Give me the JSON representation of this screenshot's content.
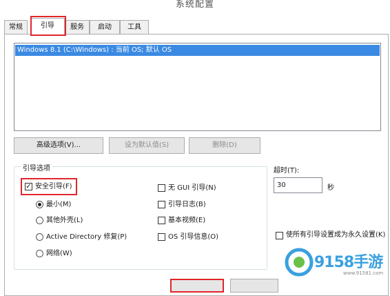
{
  "window": {
    "title": "系统配置"
  },
  "tabs": [
    {
      "label": "常规"
    },
    {
      "label": "引导"
    },
    {
      "label": "服务"
    },
    {
      "label": "启动"
    },
    {
      "label": "工具"
    }
  ],
  "boot_list": {
    "items": [
      "Windows 8.1 (C:\\Windows) : 当前 OS; 默认 OS"
    ]
  },
  "buttons": {
    "advanced": "高级选项(V)...",
    "set_default": "设为默认值(S)",
    "delete": "删除(D)"
  },
  "boot_options": {
    "group_label": "引导选项",
    "safe_boot": {
      "label": "安全引导(F)",
      "checked": true
    },
    "radios": [
      {
        "label": "最小(M)",
        "selected": true
      },
      {
        "label": "其他外壳(L)",
        "selected": false
      },
      {
        "label": "Active Directory 修复(P)",
        "selected": false
      },
      {
        "label": "网络(W)",
        "selected": false
      }
    ],
    "checks": [
      {
        "label": "无 GUI 引导(N)",
        "checked": false
      },
      {
        "label": "引导日志(B)",
        "checked": false
      },
      {
        "label": "基本视频(E)",
        "checked": false
      },
      {
        "label": "OS 引导信息(O)",
        "checked": false
      }
    ]
  },
  "timeout": {
    "label": "超时(T):",
    "value": "30",
    "unit": "秒"
  },
  "permanent": {
    "label": "使所有引导设置成为永久设置(K)",
    "checked": false
  },
  "watermark": {
    "brand": "9158手游",
    "url": "www.91581.com"
  },
  "colors": {
    "selection": "#3a8ae3",
    "highlight": "#e0252a",
    "watermark": "#3aa0e0"
  }
}
